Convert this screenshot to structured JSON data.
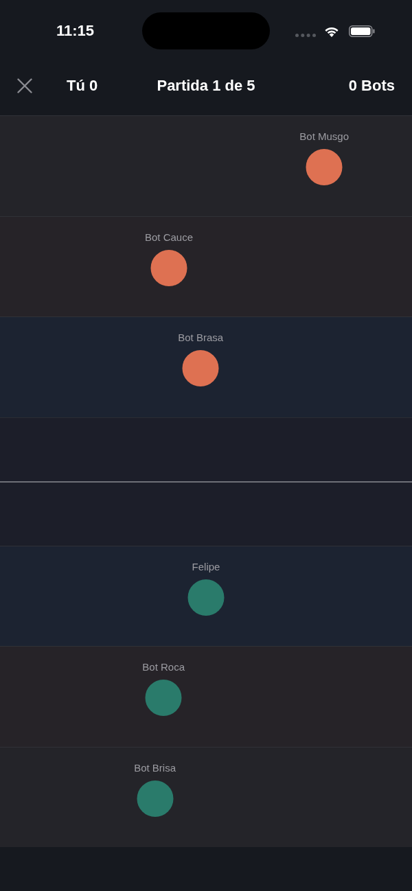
{
  "status_bar": {
    "time": "11:15"
  },
  "header": {
    "player_score": "Tú 0",
    "title": "Partida 1 de 5",
    "bots_score": "0 Bots"
  },
  "opponent_lanes": [
    {
      "name": "Bot Musgo",
      "level": 0.787,
      "color": "#de7152"
    },
    {
      "name": "Bot Cauce",
      "level": 0.41,
      "color": "#de7152"
    },
    {
      "name": "Bot Brasa",
      "level": 0.487,
      "color": "#de7152"
    }
  ],
  "team_lanes": [
    {
      "name": "Felipe",
      "level": 0.5,
      "color": "#2a7b6b"
    },
    {
      "name": "Bot Roca",
      "level": 0.397,
      "color": "#2a7b6b"
    },
    {
      "name": "Bot Brisa",
      "level": 0.376,
      "color": "#2a7b6b"
    }
  ]
}
